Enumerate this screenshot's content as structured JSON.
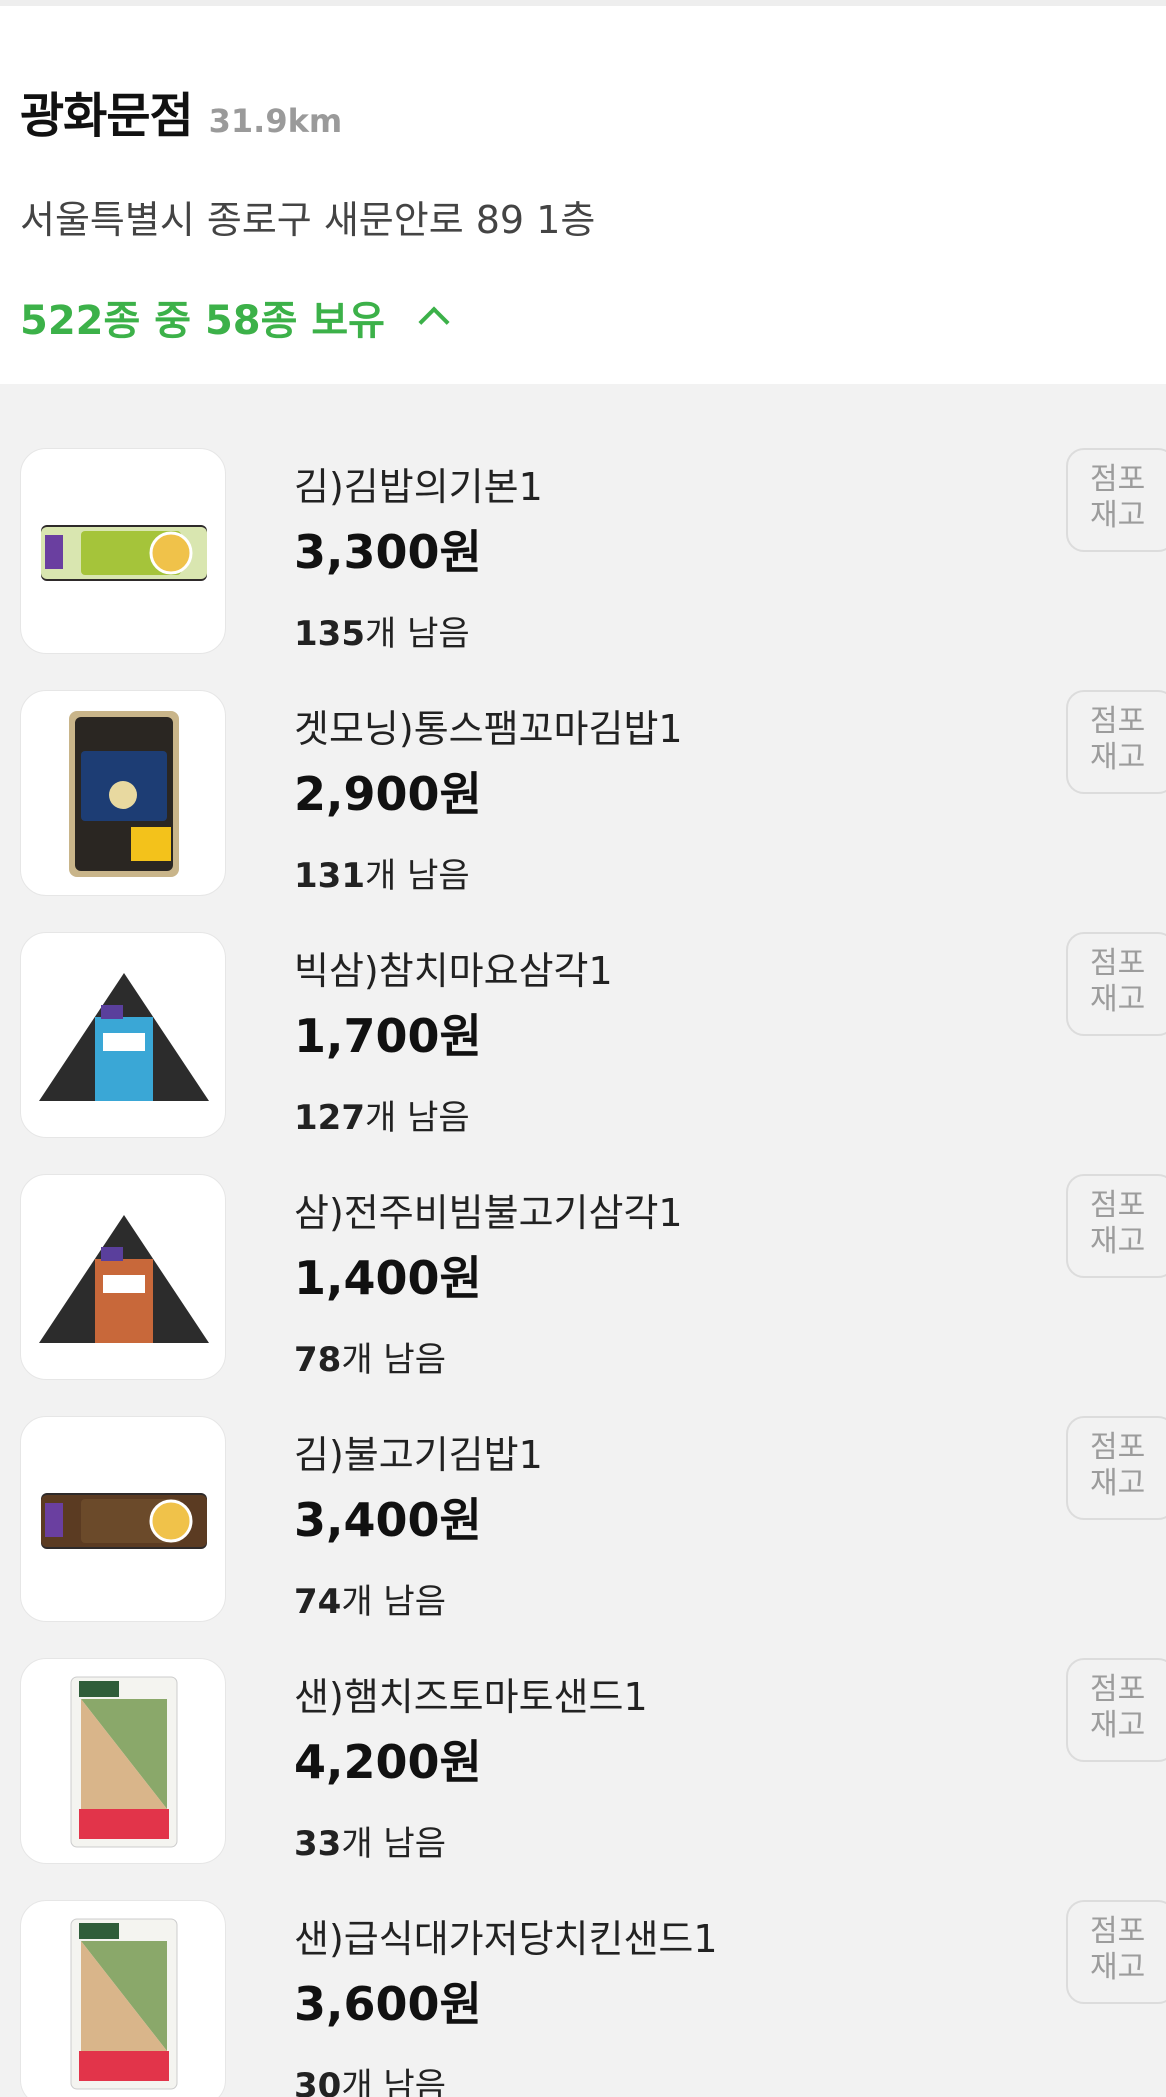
{
  "store": {
    "name": "광화문점",
    "distance": "31.9km",
    "address": "서울특별시 종로구 새문안로 89 1층",
    "stock_summary": "522종 중 58종 보유"
  },
  "stock_button": {
    "line1": "점포",
    "line2": "재고"
  },
  "items": [
    {
      "name": "김)김밥의기본1",
      "price": "3,300원",
      "count": "135",
      "count_suffix": "개 남음",
      "image": "kimbap-roll-image"
    },
    {
      "name": "겟모닝)통스팸꼬마김밥1",
      "price": "2,900원",
      "count": "131",
      "count_suffix": "개 남음",
      "image": "mini-kimbap-tray-image"
    },
    {
      "name": "빅삼)참치마요삼각1",
      "price": "1,700원",
      "count": "127",
      "count_suffix": "개 남음",
      "image": "triangle-kimbap-image"
    },
    {
      "name": "삼)전주비빔불고기삼각1",
      "price": "1,400원",
      "count": "78",
      "count_suffix": "개 남음",
      "image": "triangle-kimbap-image"
    },
    {
      "name": "김)불고기김밥1",
      "price": "3,400원",
      "count": "74",
      "count_suffix": "개 남음",
      "image": "kimbap-roll-image"
    },
    {
      "name": "샌)햄치즈토마토샌드1",
      "price": "4,200원",
      "count": "33",
      "count_suffix": "개 남음",
      "image": "sandwich-image"
    },
    {
      "name": "샌)급식대가저당치킨샌드1",
      "price": "3,600원",
      "count": "30",
      "count_suffix": "개 남음",
      "image": "sandwich-image"
    }
  ],
  "colors": {
    "accent": "#3cb149",
    "muted": "#9a9a9a"
  }
}
